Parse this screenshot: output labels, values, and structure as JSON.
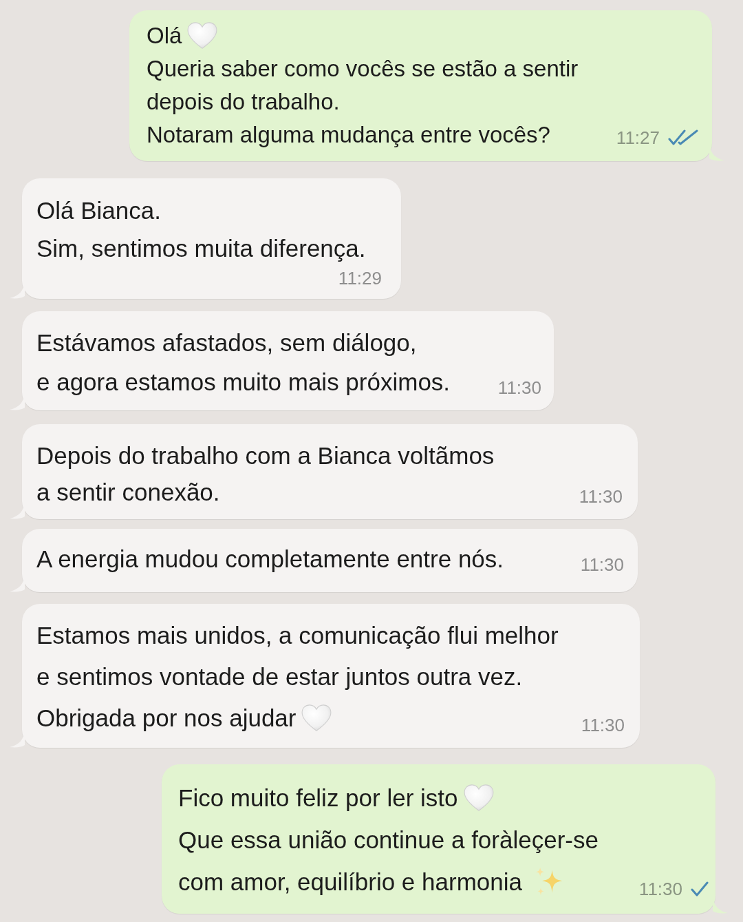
{
  "messages": [
    {
      "kind": "sent",
      "lines": [
        {
          "kind": "heart",
          "text": "Olá"
        },
        {
          "kind": "plain",
          "text": "Queria saber como vocês se estão a sentir"
        },
        {
          "kind": "plain",
          "text": "depois do trabalho."
        },
        {
          "kind": "plain",
          "text": "Notaram alguma mudança entre vocês?"
        }
      ],
      "time": "11:27",
      "read": true
    },
    {
      "kind": "received",
      "lines": [
        {
          "kind": "plain",
          "text": "Olá Bianca."
        },
        {
          "kind": "plain",
          "text": "Sim, sentimos muita diferença."
        }
      ],
      "time": "11:29"
    },
    {
      "kind": "received",
      "lines": [
        {
          "kind": "plain",
          "text": "Estávamos afastados, sem diálogo,"
        },
        {
          "kind": "plain",
          "text": "e agora estamos muito mais próximos."
        }
      ],
      "time": "11:30"
    },
    {
      "kind": "received",
      "lines": [
        {
          "kind": "plain",
          "text": "Depois do trabalho com a Bianca voltãmos"
        },
        {
          "kind": "plain",
          "text": "a sentir conexão."
        }
      ],
      "time": "11:30"
    },
    {
      "kind": "received",
      "lines": [
        {
          "kind": "plain",
          "text": "A energia mudou completamente entre nós."
        }
      ],
      "time": "11:30"
    },
    {
      "kind": "received",
      "lines": [
        {
          "kind": "plain",
          "text": "Estamos mais unidos, a comunicação flui melhor"
        },
        {
          "kind": "plain",
          "text": "e sentimos vontade de estar juntos outra vez."
        },
        {
          "kind": "heart",
          "text": "Obrigada por nos ajudar"
        }
      ],
      "time": "11:30"
    },
    {
      "kind": "sent",
      "lines": [
        {
          "kind": "heart",
          "text": "Fico muito feliz por ler isto"
        },
        {
          "kind": "plain",
          "text": "Que essa união continue a foràleçer-se"
        },
        {
          "kind": "sparkles",
          "text": "com amor, equilíbrio e harmonia"
        }
      ],
      "time": "11:30",
      "read": false
    }
  ]
}
